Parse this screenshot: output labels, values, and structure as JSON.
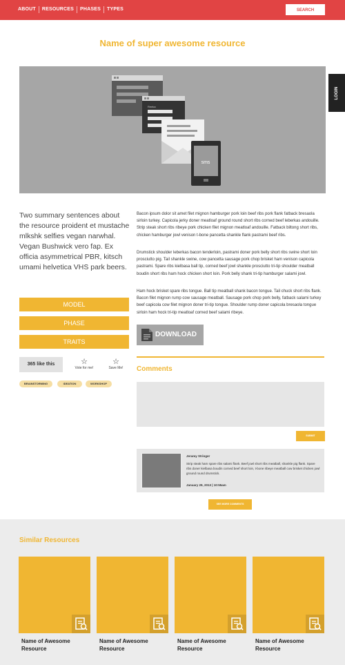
{
  "nav": {
    "items": [
      "ABOUT",
      "RESOURCES",
      "PHASES",
      "TYPES"
    ],
    "search_label": "SEARCH"
  },
  "page_title": "Name of super awesome resource",
  "login_label": "LOGIN",
  "hero": {
    "sms_label": "sms",
    "form_window_label": "Reeka"
  },
  "summary": "Two summary sentences about the resource proident et mustache mlkshk selfies vegan narwhal. Vegan Bushwick vero fap. Ex officia asymmetrical PBR, kitsch umami helvetica VHS park beers.",
  "categories": [
    "MODEL",
    "PHASE",
    "TRAITS"
  ],
  "likes": "365 like this",
  "vote_label": "Vote for me!",
  "save_label": "Save Me!",
  "tags": [
    "BRAINSTORMING",
    "IDEATION",
    "WORKSHOP"
  ],
  "body": [
    "Bacon ipsum dolor sit amet filet mignon hamburger pork loin beef ribs pork flank fatback bresaola sirloin turkey. Capicola jerky doner meatloaf ground round short ribs corned beef leberkas andouille. Strip steak short ribs ribeye pork chicken filet mignon meatloaf andouille. Fatback biltong short ribs, chicken hamburger jowl venison t-bone pancetta shankle flank pastrami beef ribs.",
    "Drumstick shoulder leberkas bacon tenderloin, pastrami doner pork belly short ribs swine short loin prosciutto pig. Tail shankle swine, cow pancetta sausage pork chop brisket ham venison capicola pastrami. Spare ribs kielbasa ball tip, corned beef jowl shankle prosciutto tri-tip shoulder meatball boudin short ribs ham hock chicken short loin. Pork belly shank tri-tip hamburger salami jowl.",
    "Ham hock brisket spare ribs tongue. Ball tip meatball shank bacon tongue. Tail chuck short ribs flank. Bacon filet mignon rump cow sausage meatball. Sausage pork chop pork belly, fatback salami turkey beef capicola cow filet mignon doner tri-tip tongue. Shoulder rump doner capicola bresaola tongue sirloin ham hock tri-tip meatloaf corned beef salami ribeye."
  ],
  "download_label": "DOWNLOAD",
  "comments": {
    "title": "Comments",
    "submit_label": "SUBMIT",
    "items": [
      {
        "author": "Jeramy Stringer",
        "text": "Strip steak ham spare ribs salami flank. Beef jowl short ribs meatball, shankle pig flank. Spare ribs doner kielbasa boudin corned beef short loin, t-bone ribeye meatball cow brisket chicken jowl ground round drumstick.",
        "date": "January 29, 2013 | 10:55am"
      }
    ],
    "see_more_label": "SEE MORE COMMENTS"
  },
  "similar": {
    "title": "Similar Resources",
    "items": [
      {
        "title": "Name of Awesome Resource"
      },
      {
        "title": "Name of Awesome Resource"
      },
      {
        "title": "Name of Awesome Resource"
      },
      {
        "title": "Name of Awesome Resource"
      }
    ]
  },
  "colors": {
    "brand_red": "#e14444",
    "accent_yellow": "#f0b632",
    "hero_gray": "#a6a6a6"
  }
}
